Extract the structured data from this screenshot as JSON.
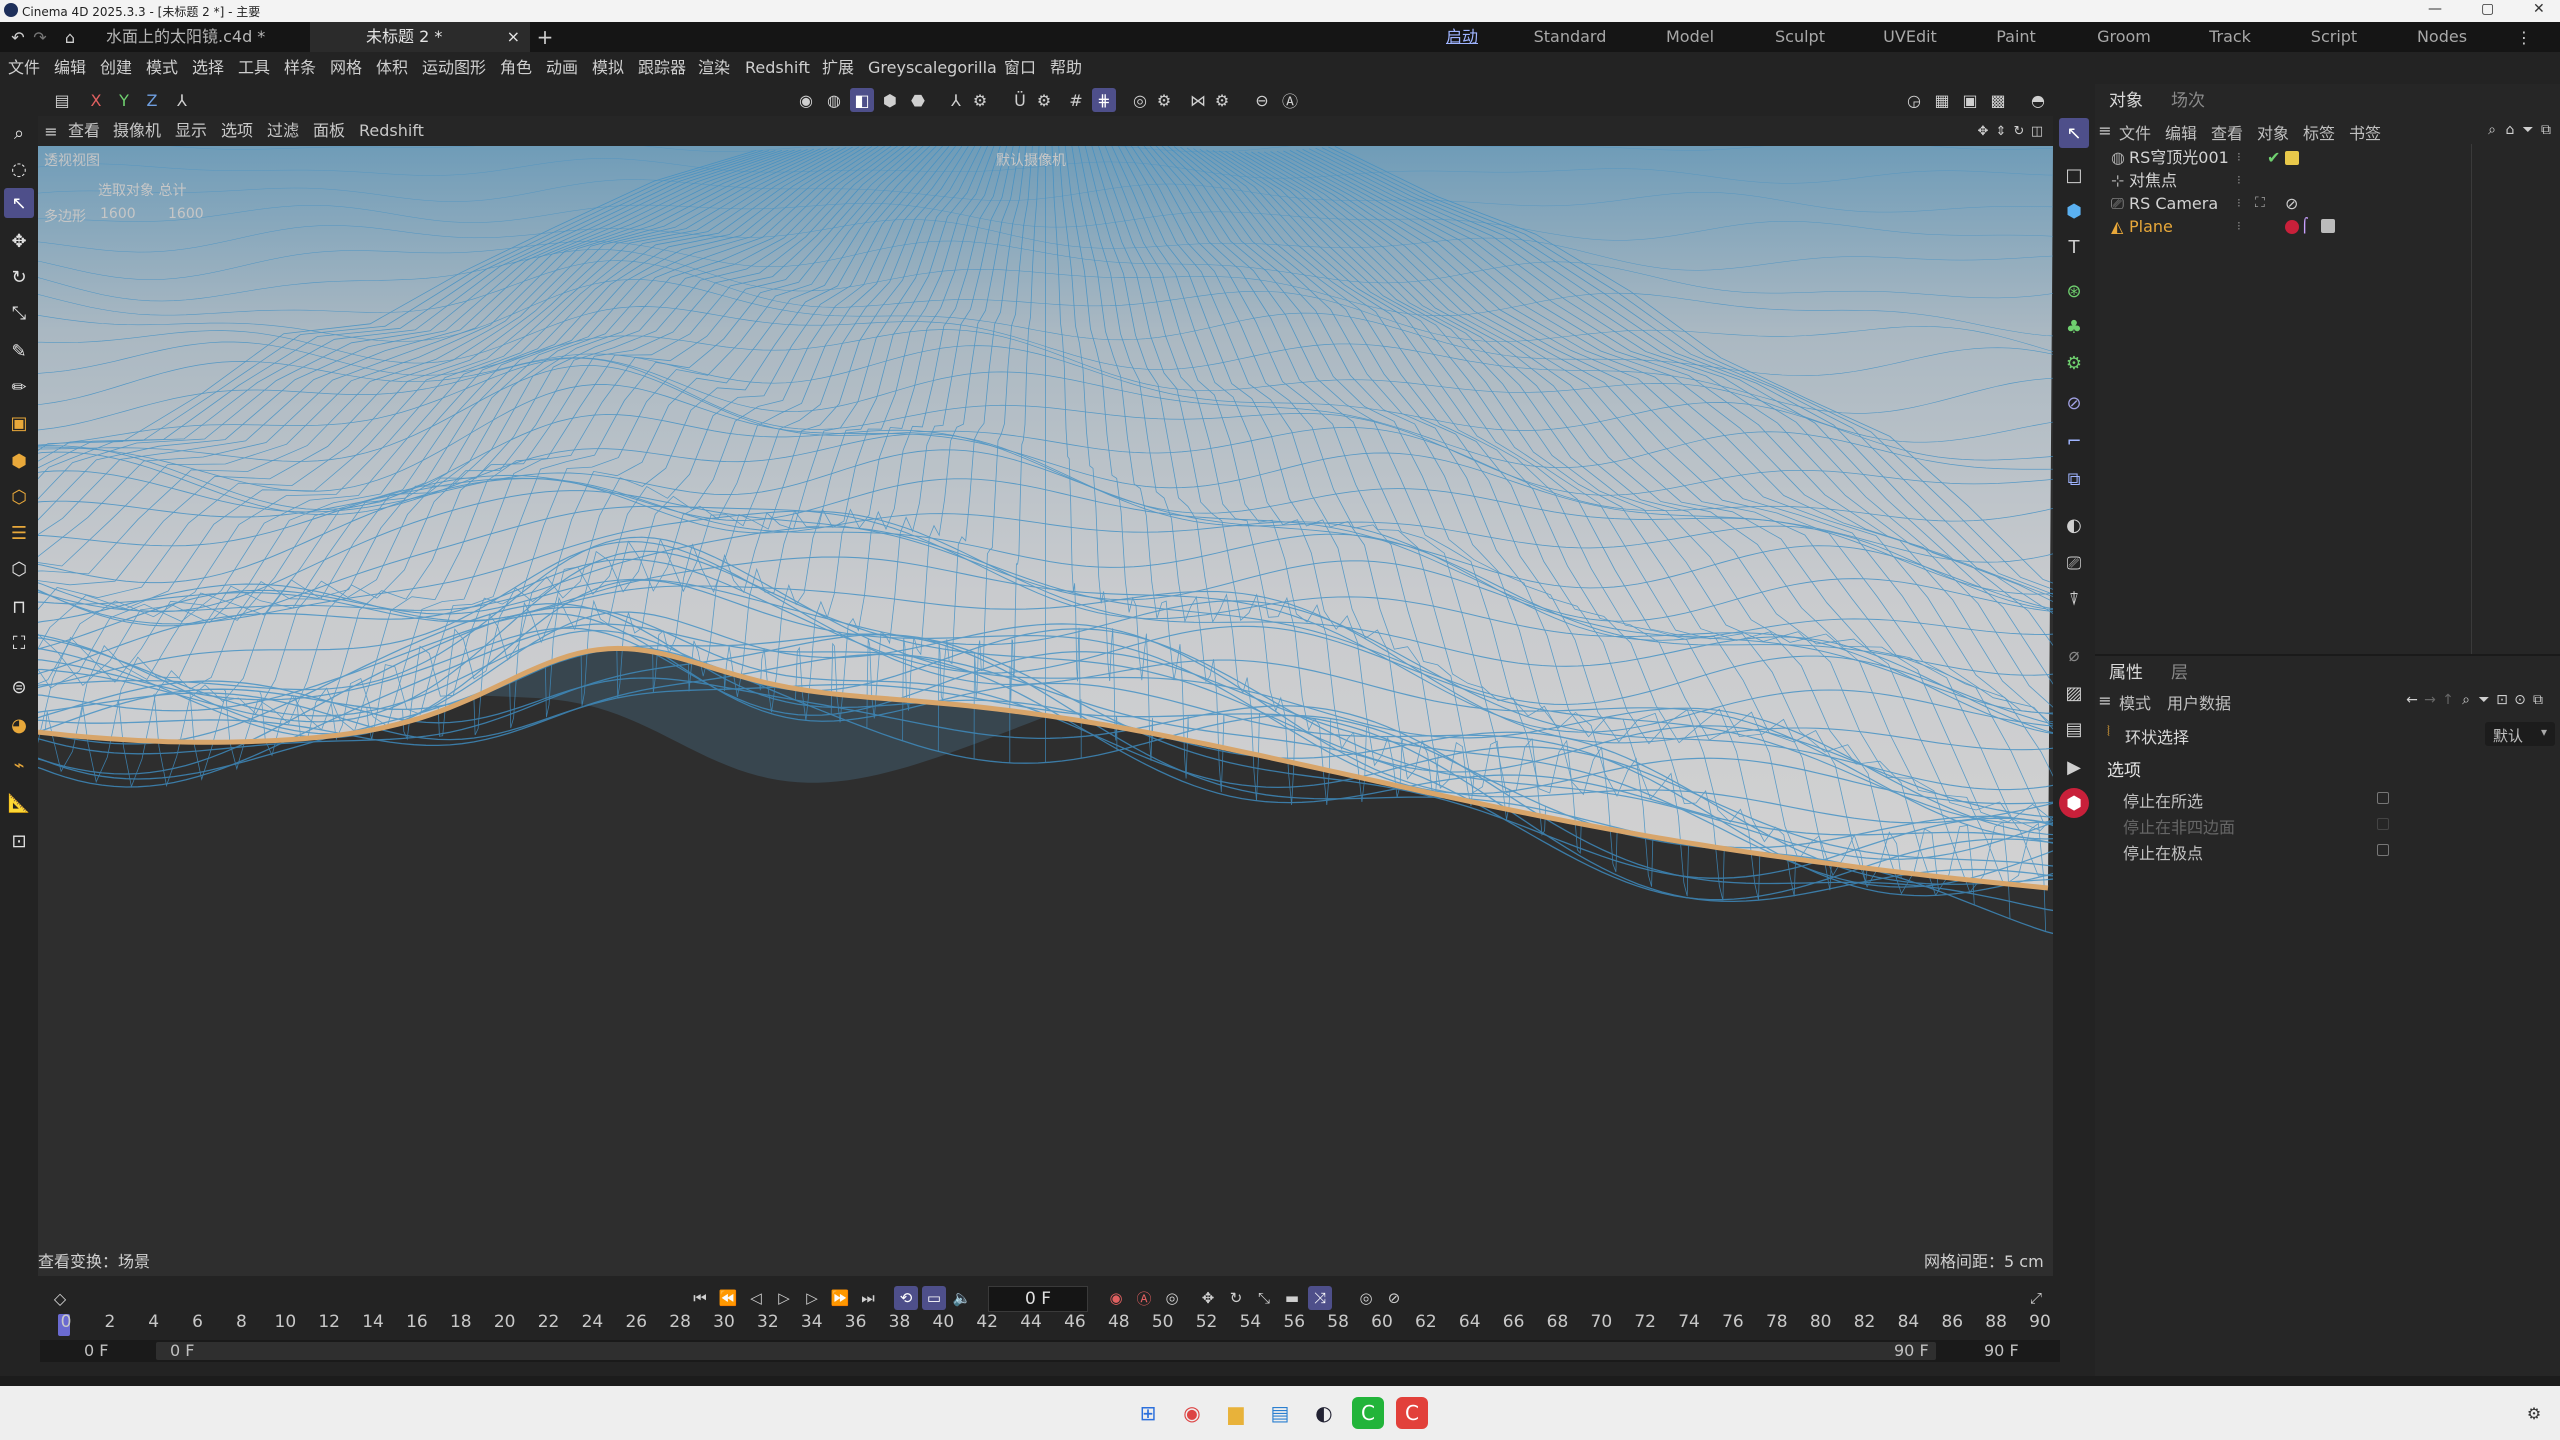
{
  "window": {
    "title": "Cinema 4D 2025.3.3 - [未标题 2 *] - 主要",
    "controls": [
      "—",
      "▢",
      "✕"
    ]
  },
  "tabs": {
    "docs": [
      {
        "label": "水面上的太阳镜.c4d *",
        "active": false
      },
      {
        "label": "未标题 2 *",
        "active": true
      }
    ],
    "close": "×",
    "add": "+",
    "layouts": [
      "启动",
      "Standard",
      "Model",
      "Sculpt",
      "UVEdit",
      "Paint",
      "Groom",
      "Track",
      "Script",
      "Nodes"
    ],
    "active_layout": "启动",
    "more": "⋮"
  },
  "menu": [
    "文件",
    "编辑",
    "创建",
    "模式",
    "选择",
    "工具",
    "样条",
    "网格",
    "体积",
    "运动图形",
    "角色",
    "动画",
    "模拟",
    "跟踪器",
    "渲染",
    "Redshift",
    "扩展",
    "Greyscalegorilla",
    "窗口",
    "帮助"
  ],
  "axis_lock": [
    "X",
    "Y",
    "Z"
  ],
  "viewport": {
    "menu": [
      "查看",
      "摄像机",
      "显示",
      "选项",
      "过滤",
      "面板",
      "Redshift"
    ],
    "view_name": "透视视图",
    "camera": "默认摄像机",
    "hud_selected": "选取对象  总计",
    "hud_polys_label": "多边形",
    "hud_polys_sel": "1600",
    "hud_polys_total": "1600",
    "status": "查看变换：场景",
    "grid": "网格间距：5 cm"
  },
  "objects": {
    "tabs": [
      "对象",
      "场次"
    ],
    "menu": [
      "文件",
      "编辑",
      "查看",
      "对象",
      "标签",
      "书签"
    ],
    "rows": [
      {
        "name": "RS穹顶光001",
        "icon": "◍"
      },
      {
        "name": "对焦点",
        "icon": "⊹"
      },
      {
        "name": "RS Camera",
        "icon": "⎚"
      },
      {
        "name": "Plane",
        "icon": "◭",
        "selected": true
      }
    ]
  },
  "attributes": {
    "tabs": [
      "属性",
      "层"
    ],
    "menu": [
      "模式",
      "用户数据"
    ],
    "tool_name": "环状选择",
    "preset": "默认",
    "section": "选项",
    "options": [
      {
        "label": "停止在所选",
        "enabled": true
      },
      {
        "label": "停止在非四边面",
        "enabled": false
      },
      {
        "label": "停止在极点",
        "enabled": true
      }
    ]
  },
  "timeline": {
    "current_frame": "0 F",
    "ticks": [
      "0",
      "2",
      "4",
      "6",
      "8",
      "10",
      "12",
      "14",
      "16",
      "18",
      "20",
      "22",
      "24",
      "26",
      "28",
      "30",
      "32",
      "34",
      "36",
      "38",
      "40",
      "42",
      "44",
      "46",
      "48",
      "50",
      "52",
      "54",
      "56",
      "58",
      "60",
      "62",
      "64",
      "66",
      "68",
      "70",
      "72",
      "74",
      "76",
      "78",
      "80",
      "82",
      "84",
      "86",
      "88",
      "90"
    ],
    "start": "0 F",
    "preview_start": "0 F",
    "preview_end": "90 F",
    "end": "90 F"
  },
  "colors": {
    "accent": "#4e4f8a",
    "wire": "#3f8fc4",
    "edge": "#d8a56a",
    "selected_obj": "#e8a83a"
  }
}
